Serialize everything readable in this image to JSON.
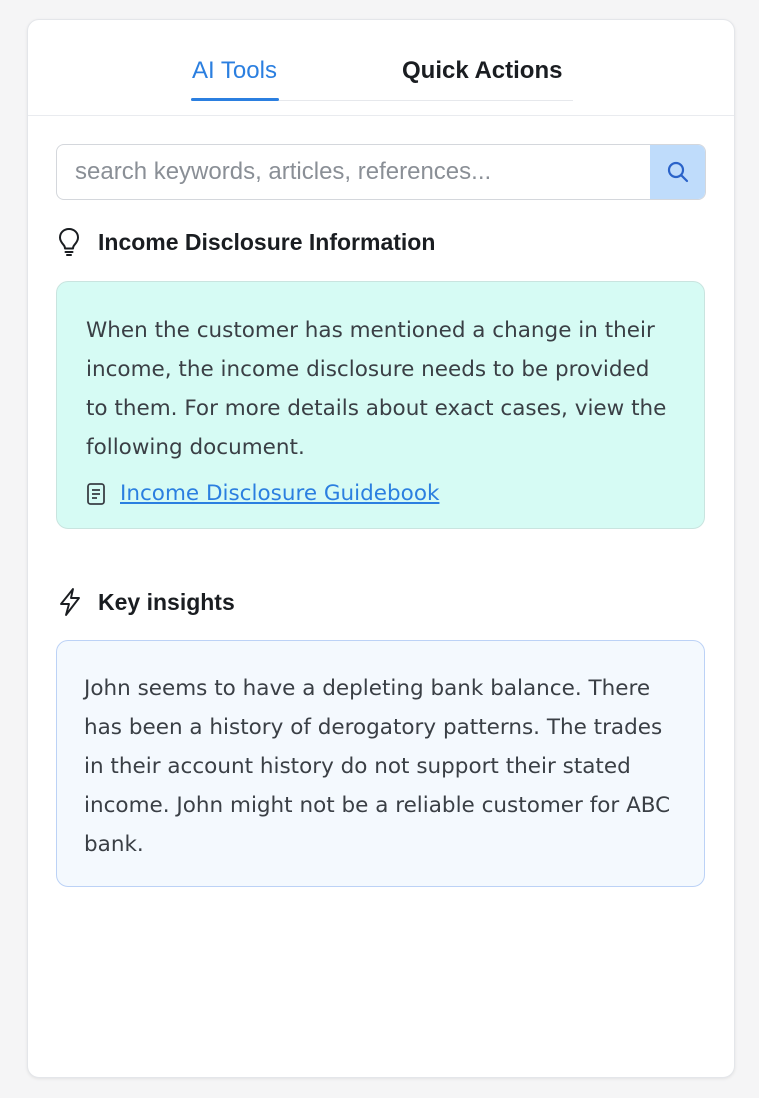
{
  "tabs": [
    {
      "label": "AI Tools",
      "active": true
    },
    {
      "label": "Quick Actions",
      "active": false
    }
  ],
  "search": {
    "placeholder": "search keywords, articles, references...",
    "value": "",
    "icon": "search-icon"
  },
  "income_section": {
    "title": "Income Disclosure Information",
    "icon": "lightbulb-icon",
    "body": "When the customer has mentioned a change in their income, the income disclosure needs to be provided to them. For more details about exact cases, view the following document.",
    "link_icon": "document-icon",
    "link_label": "Income Disclosure Guidebook"
  },
  "insights_section": {
    "title": "Key insights",
    "icon": "lightning-icon",
    "body": "John seems to have a depleting bank balance. There has been a history of derogatory patterns. The trades in their account history do not support their stated income. John might not be a reliable customer for ABC bank."
  },
  "colors": {
    "accent": "#2b7fe0",
    "income_card_bg": "#d6fbf4",
    "insights_card_bg": "#f4f9fe",
    "search_button_bg": "#bfdcfb"
  }
}
